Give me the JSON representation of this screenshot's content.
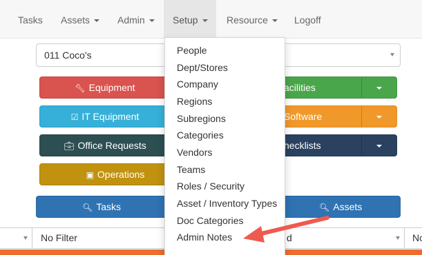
{
  "navbar": {
    "items": [
      {
        "label": "Tasks",
        "has_caret": false
      },
      {
        "label": "Assets",
        "has_caret": true
      },
      {
        "label": "Admin",
        "has_caret": true
      },
      {
        "label": "Setup",
        "has_caret": true,
        "active": true
      },
      {
        "label": "Resource",
        "has_caret": true
      },
      {
        "label": "Logoff",
        "has_caret": false
      }
    ]
  },
  "store_select": {
    "value": "011 Coco's"
  },
  "buttons": {
    "equipment": {
      "label": "Equipment",
      "icon": "wrench-icon",
      "color": "#d9534f"
    },
    "facilities": {
      "label": "acilities",
      "color": "#4aa64a"
    },
    "it_equipment": {
      "label": "IT Equipment",
      "icon": "check-square-icon",
      "color": "#36b0d8"
    },
    "software": {
      "label": "Software",
      "color": "#f0992a"
    },
    "office_requests": {
      "label": "Office Requests",
      "icon": "briefcase-icon",
      "color": "#2d4f52"
    },
    "checklists": {
      "label": "hecklists",
      "color": "#2a4260"
    },
    "operations": {
      "label": "Operations",
      "icon": "book-icon",
      "color": "#c1920f"
    },
    "tasks": {
      "label": "Tasks",
      "icon": "search-icon",
      "color": "#2f73b3"
    },
    "assets": {
      "label": "Assets",
      "icon": "search-icon",
      "color": "#2f73b3"
    }
  },
  "filters": {
    "filter_2": {
      "value": "No Filter"
    },
    "filter_3": {
      "value": "d"
    },
    "filter_4": {
      "value": "No"
    }
  },
  "setup_menu": {
    "items": [
      "People",
      "Dept/Stores",
      "Company",
      "Regions",
      "Subregions",
      "Categories",
      "Vendors",
      "Teams",
      "Roles / Security",
      "Asset / Inventory Types",
      "Doc Categories",
      "Admin Notes"
    ]
  },
  "colors": {
    "annotation_arrow": "#ef5a4f",
    "bottom_bar": "#ef6c2f"
  }
}
